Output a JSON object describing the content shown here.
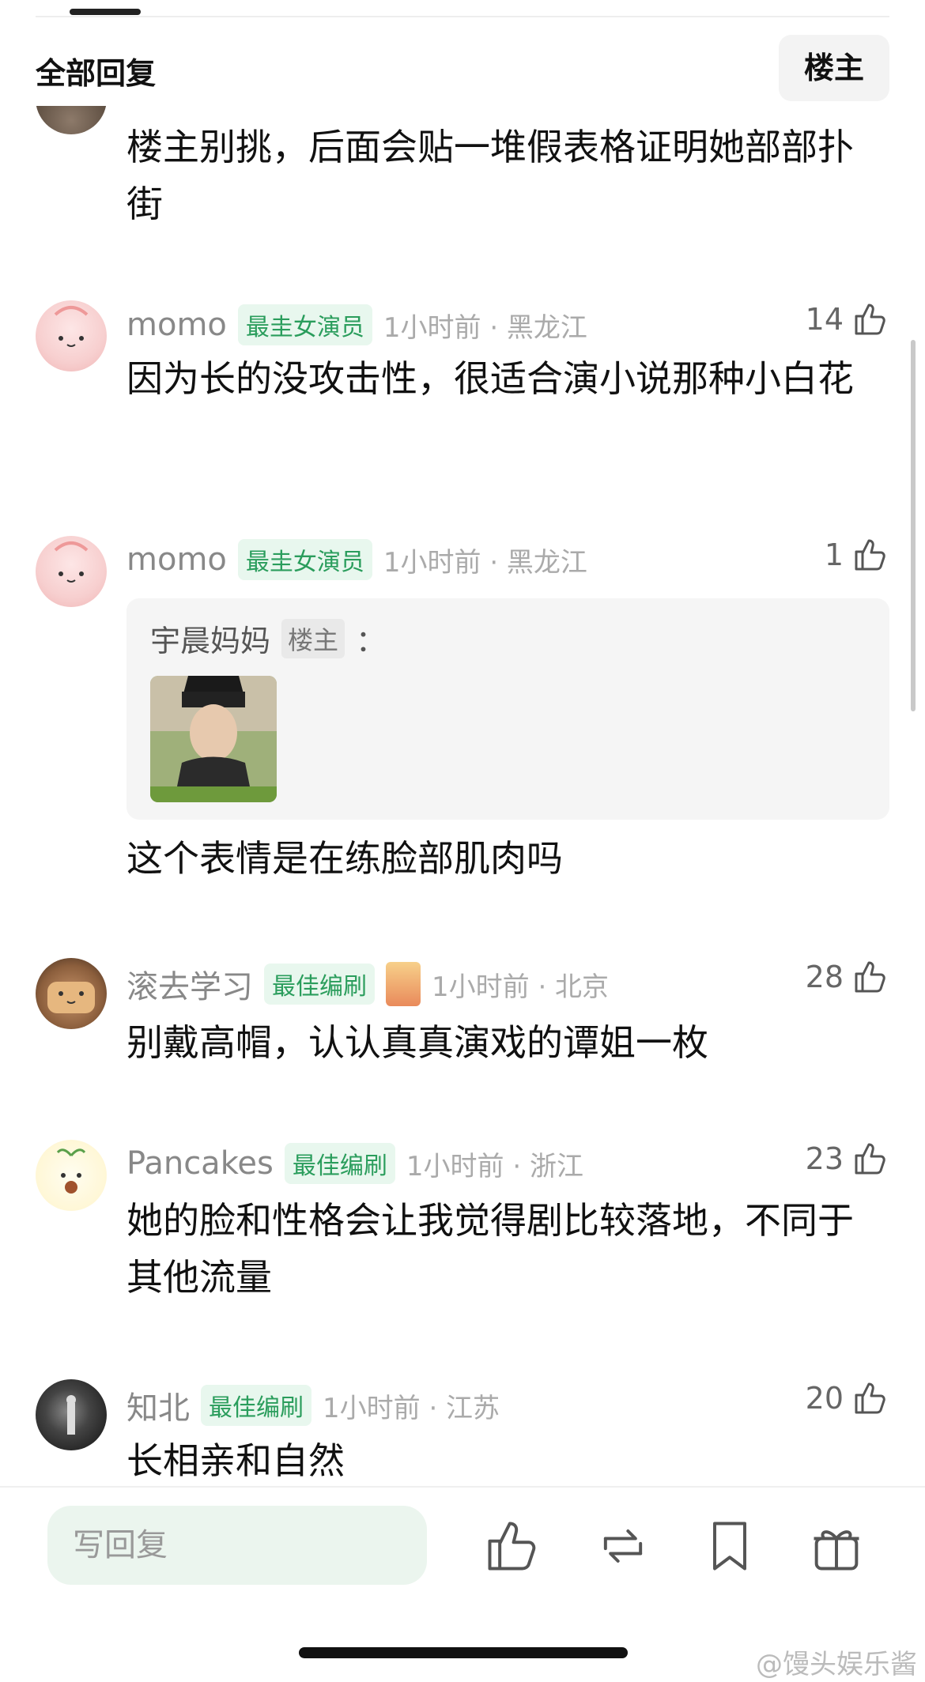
{
  "header": {
    "title": "全部回复",
    "op_button": "楼主"
  },
  "comments": [
    {
      "text": "楼主别挑，后面会贴一堆假表格证明她部部扑街"
    },
    {
      "user": "momo",
      "badge": "最圭女演员",
      "meta": "1小时前 · 黑龙江",
      "likes": "14",
      "text": "因为长的没攻击性，很适合演小说那种小白花"
    },
    {
      "user": "momo",
      "badge": "最圭女演员",
      "meta": "1小时前 · 黑龙江",
      "likes": "1",
      "quote": {
        "author": "宇晨妈妈",
        "badge": "楼主",
        "colon": "："
      },
      "text": "这个表情是在练脸部肌肉吗"
    },
    {
      "user": "滚去学习",
      "badge": "最佳编刷",
      "meta": "1小时前 · 北京",
      "likes": "28",
      "text": "别戴高帽，认认真真演戏的谭姐一枚"
    },
    {
      "user": "Pancakes",
      "badge": "最佳编刷",
      "meta": "1小时前 · 浙江",
      "likes": "23",
      "text": "她的脸和性格会让我觉得剧比较落地，不同于其他流量"
    },
    {
      "user": "知北",
      "badge": "最佳编刷",
      "meta": "1小时前 · 江苏",
      "likes": "20",
      "text": "长相亲和自然"
    }
  ],
  "bottom": {
    "placeholder": "写回复"
  },
  "watermark": "@馒头娱乐酱",
  "colors": {
    "badge_green": "#2a9d5c",
    "badge_bg": "#e8f7ee",
    "input_bg": "#ebf5ee"
  }
}
